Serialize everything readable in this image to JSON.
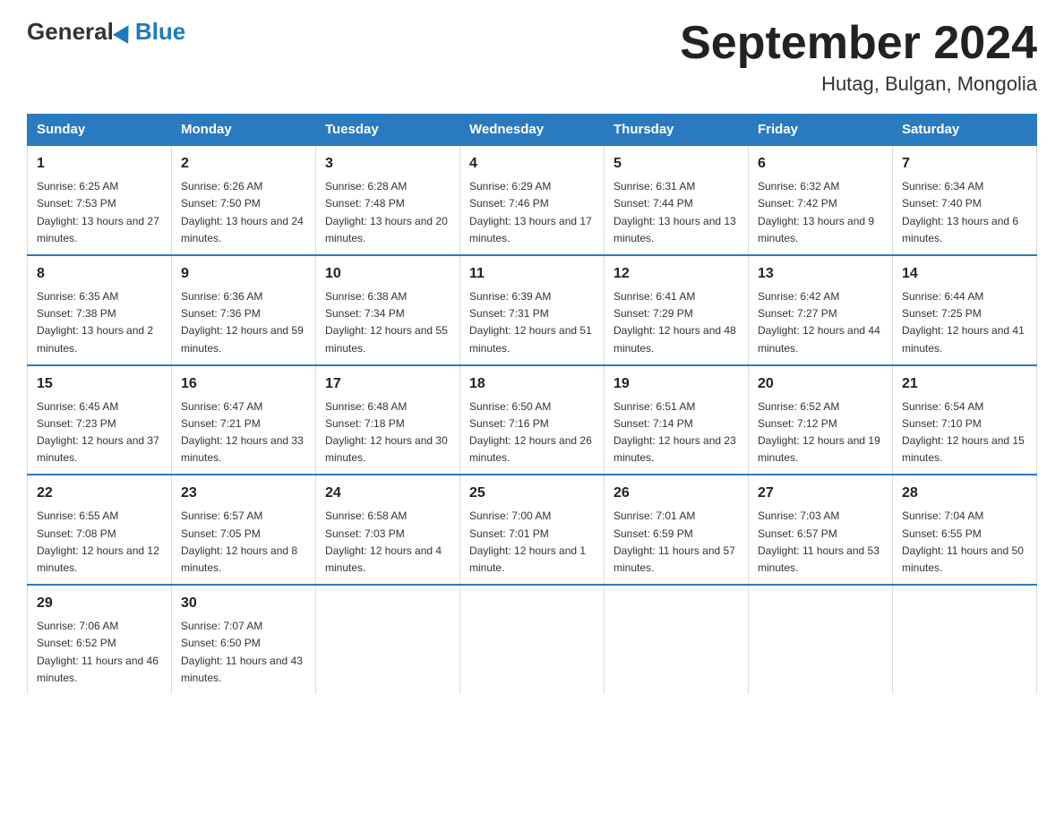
{
  "header": {
    "logo": {
      "general": "General",
      "blue": "Blue"
    },
    "title": "September 2024",
    "location": "Hutag, Bulgan, Mongolia"
  },
  "calendar": {
    "days": [
      "Sunday",
      "Monday",
      "Tuesday",
      "Wednesday",
      "Thursday",
      "Friday",
      "Saturday"
    ],
    "weeks": [
      [
        {
          "day": "1",
          "sunrise": "6:25 AM",
          "sunset": "7:53 PM",
          "daylight": "13 hours and 27 minutes."
        },
        {
          "day": "2",
          "sunrise": "6:26 AM",
          "sunset": "7:50 PM",
          "daylight": "13 hours and 24 minutes."
        },
        {
          "day": "3",
          "sunrise": "6:28 AM",
          "sunset": "7:48 PM",
          "daylight": "13 hours and 20 minutes."
        },
        {
          "day": "4",
          "sunrise": "6:29 AM",
          "sunset": "7:46 PM",
          "daylight": "13 hours and 17 minutes."
        },
        {
          "day": "5",
          "sunrise": "6:31 AM",
          "sunset": "7:44 PM",
          "daylight": "13 hours and 13 minutes."
        },
        {
          "day": "6",
          "sunrise": "6:32 AM",
          "sunset": "7:42 PM",
          "daylight": "13 hours and 9 minutes."
        },
        {
          "day": "7",
          "sunrise": "6:34 AM",
          "sunset": "7:40 PM",
          "daylight": "13 hours and 6 minutes."
        }
      ],
      [
        {
          "day": "8",
          "sunrise": "6:35 AM",
          "sunset": "7:38 PM",
          "daylight": "13 hours and 2 minutes."
        },
        {
          "day": "9",
          "sunrise": "6:36 AM",
          "sunset": "7:36 PM",
          "daylight": "12 hours and 59 minutes."
        },
        {
          "day": "10",
          "sunrise": "6:38 AM",
          "sunset": "7:34 PM",
          "daylight": "12 hours and 55 minutes."
        },
        {
          "day": "11",
          "sunrise": "6:39 AM",
          "sunset": "7:31 PM",
          "daylight": "12 hours and 51 minutes."
        },
        {
          "day": "12",
          "sunrise": "6:41 AM",
          "sunset": "7:29 PM",
          "daylight": "12 hours and 48 minutes."
        },
        {
          "day": "13",
          "sunrise": "6:42 AM",
          "sunset": "7:27 PM",
          "daylight": "12 hours and 44 minutes."
        },
        {
          "day": "14",
          "sunrise": "6:44 AM",
          "sunset": "7:25 PM",
          "daylight": "12 hours and 41 minutes."
        }
      ],
      [
        {
          "day": "15",
          "sunrise": "6:45 AM",
          "sunset": "7:23 PM",
          "daylight": "12 hours and 37 minutes."
        },
        {
          "day": "16",
          "sunrise": "6:47 AM",
          "sunset": "7:21 PM",
          "daylight": "12 hours and 33 minutes."
        },
        {
          "day": "17",
          "sunrise": "6:48 AM",
          "sunset": "7:18 PM",
          "daylight": "12 hours and 30 minutes."
        },
        {
          "day": "18",
          "sunrise": "6:50 AM",
          "sunset": "7:16 PM",
          "daylight": "12 hours and 26 minutes."
        },
        {
          "day": "19",
          "sunrise": "6:51 AM",
          "sunset": "7:14 PM",
          "daylight": "12 hours and 23 minutes."
        },
        {
          "day": "20",
          "sunrise": "6:52 AM",
          "sunset": "7:12 PM",
          "daylight": "12 hours and 19 minutes."
        },
        {
          "day": "21",
          "sunrise": "6:54 AM",
          "sunset": "7:10 PM",
          "daylight": "12 hours and 15 minutes."
        }
      ],
      [
        {
          "day": "22",
          "sunrise": "6:55 AM",
          "sunset": "7:08 PM",
          "daylight": "12 hours and 12 minutes."
        },
        {
          "day": "23",
          "sunrise": "6:57 AM",
          "sunset": "7:05 PM",
          "daylight": "12 hours and 8 minutes."
        },
        {
          "day": "24",
          "sunrise": "6:58 AM",
          "sunset": "7:03 PM",
          "daylight": "12 hours and 4 minutes."
        },
        {
          "day": "25",
          "sunrise": "7:00 AM",
          "sunset": "7:01 PM",
          "daylight": "12 hours and 1 minute."
        },
        {
          "day": "26",
          "sunrise": "7:01 AM",
          "sunset": "6:59 PM",
          "daylight": "11 hours and 57 minutes."
        },
        {
          "day": "27",
          "sunrise": "7:03 AM",
          "sunset": "6:57 PM",
          "daylight": "11 hours and 53 minutes."
        },
        {
          "day": "28",
          "sunrise": "7:04 AM",
          "sunset": "6:55 PM",
          "daylight": "11 hours and 50 minutes."
        }
      ],
      [
        {
          "day": "29",
          "sunrise": "7:06 AM",
          "sunset": "6:52 PM",
          "daylight": "11 hours and 46 minutes."
        },
        {
          "day": "30",
          "sunrise": "7:07 AM",
          "sunset": "6:50 PM",
          "daylight": "11 hours and 43 minutes."
        },
        null,
        null,
        null,
        null,
        null
      ]
    ]
  }
}
